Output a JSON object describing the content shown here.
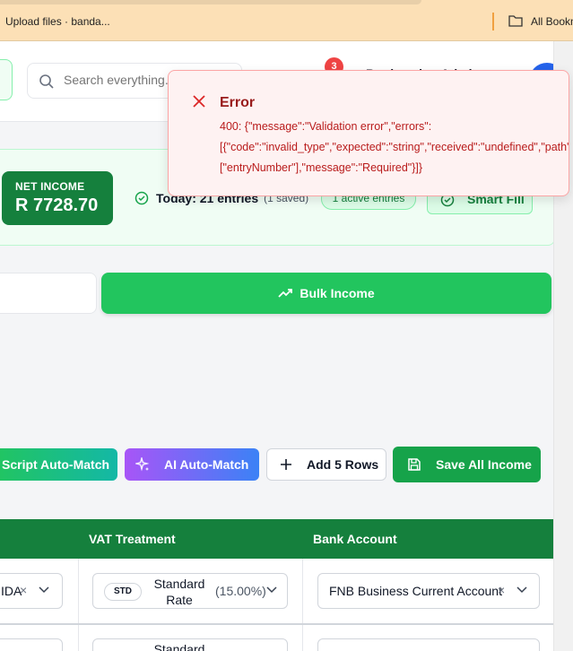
{
  "browser": {
    "bookmark_upload": "Upload files · banda...",
    "bookmark_all": "All Bookmarks"
  },
  "header": {
    "search_placeholder": "Search everything...",
    "notification_count": "3",
    "user_name": "Bookeeping Admin"
  },
  "summary": {
    "net_income_label": "NET INCOME",
    "net_income_value": "R 7728.70",
    "today_text": "Today: 21 entries",
    "saved_text": "(1 saved)",
    "active_entries": "1 active entries",
    "smart_fill_label": "Smart Fill"
  },
  "actions": {
    "bulk_income_label": "Bulk Income",
    "script_auto_match_label": "Script Auto-Match",
    "ai_auto_match_label": "AI Auto-Match",
    "add_rows_label": "Add 5 Rows",
    "save_all_label": "Save All Income"
  },
  "table": {
    "headers": {
      "vat_treatment": "VAT Treatment",
      "bank_account": "Bank Account"
    },
    "rows": [
      {
        "first_col_value": "IDA",
        "vat_badge": "STD",
        "vat_label": "Standard Rate",
        "vat_rate": "(15.00%)",
        "bank_account": "FNB Business Current Account"
      },
      {
        "vat_label": "Standard"
      }
    ]
  },
  "toast": {
    "title": "Error",
    "message_line1": "400: {\"message\":\"Validation error\",\"errors\":",
    "message_line2": "[{\"code\":\"invalid_type\",\"expected\":\"string\",\"received\":\"undefined\",\"path\":",
    "message_line3": "[\"entryNumber\"],\"message\":\"Required\"}]}"
  },
  "colors": {
    "primary_green": "#15803d",
    "button_green": "#22c55e",
    "error_red": "#dc2626",
    "notification_red": "#ef4444"
  }
}
